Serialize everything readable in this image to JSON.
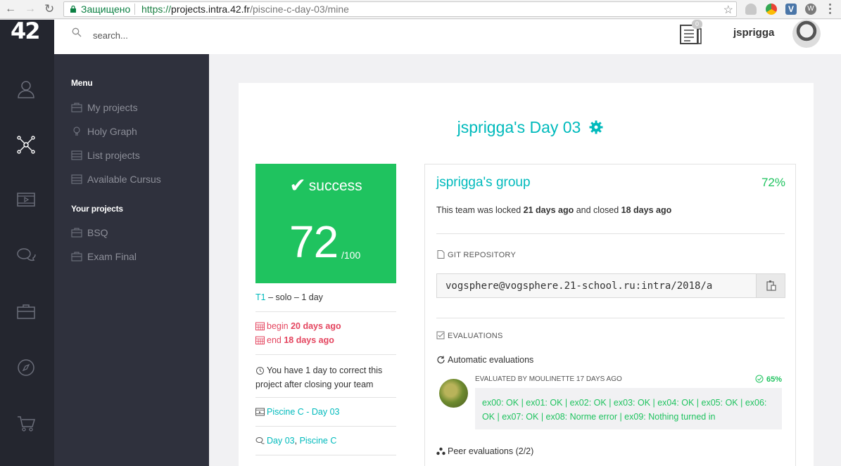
{
  "browser": {
    "secure_label": "Защищено",
    "url_scheme": "https://",
    "url_host": "projects.intra.42.fr",
    "url_path": "/piscine-c-day-03/mine",
    "ext_vk_label": "V",
    "ext_w_label": "W"
  },
  "app": {
    "logo": "42",
    "search_placeholder": "search...",
    "notification_count": "0",
    "username": "jsprigga"
  },
  "rail_icons": [
    "user-icon",
    "graph-icon",
    "video-icon",
    "chat-icon",
    "briefcase-icon",
    "compass-icon",
    "cart-icon"
  ],
  "sidebar": {
    "menu_title": "Menu",
    "menu_items": [
      {
        "label": "My projects",
        "icon": "briefcase-icon"
      },
      {
        "label": "Holy Graph",
        "icon": "bulb-icon"
      },
      {
        "label": "List projects",
        "icon": "list-icon"
      },
      {
        "label": "Available Cursus",
        "icon": "list-icon"
      }
    ],
    "your_projects_title": "Your projects",
    "project_items": [
      {
        "label": "BSQ",
        "icon": "briefcase-icon"
      },
      {
        "label": "Exam Final",
        "icon": "briefcase-icon"
      }
    ]
  },
  "project": {
    "title": "jsprigga's Day 03",
    "status": "success",
    "score": "72",
    "max": "/100",
    "tier": "T1",
    "tier_desc": " – solo – 1 day",
    "begin_label": "begin ",
    "begin_value": "20 days ago",
    "end_label": "end ",
    "end_value": "18 days ago",
    "correct_note": "You have 1 day to correct this project after closing your team",
    "cursus_link": "Piscine C - Day 03",
    "link_day": "Day 03",
    "link_sep": ", ",
    "link_piscine": "Piscine C"
  },
  "group": {
    "name": "jsprigga's group",
    "percent": "72%",
    "lock_prefix": "This team was locked ",
    "locked_ago": "21 days ago",
    "lock_mid": " and closed ",
    "closed_ago": "18 days ago",
    "git_label": "GIT REPOSITORY",
    "git_url": "vogsphere@vogsphere.21-school.ru:intra/2018/a",
    "evaluations_label": "EVALUATIONS",
    "auto_eval_label": "Automatic evaluations",
    "evaluated_by": "EVALUATED BY MOULINETTE 17 DAYS AGO",
    "eval_percent": "65%",
    "eval_result": "ex00: OK | ex01: OK | ex02: OK | ex03: OK | ex04: OK | ex05: OK | ex06: OK | ex07: OK | ex08: Norme error | ex09: Nothing turned in",
    "peer_eval_label": "Peer evaluations (2/2)"
  },
  "colors": {
    "teal": "#00babc",
    "success": "#1fc35f",
    "danger": "#e4455f",
    "rail_bg": "#24262f",
    "menu_bg": "#2f313d"
  }
}
